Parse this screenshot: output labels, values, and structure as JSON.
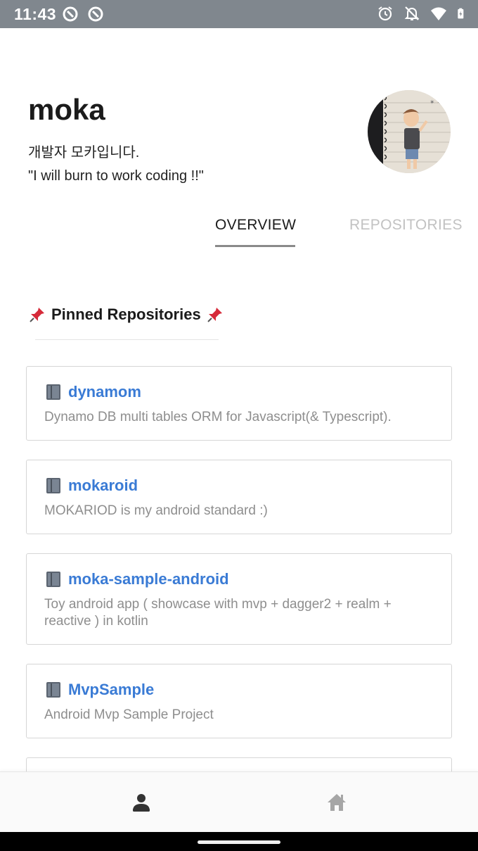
{
  "status_bar": {
    "time": "11:43",
    "left_icons": [
      "notification-circle-icon",
      "notification-circle-icon"
    ],
    "right_icons": [
      "alarm-icon",
      "notifications-off-icon",
      "wifi-icon",
      "battery-charging-icon"
    ]
  },
  "profile": {
    "name": "moka",
    "bio_line1": "개발자 모카입니다.",
    "bio_line2": "\"I will burn to work coding !!\""
  },
  "tabs": [
    {
      "label": "OVERVIEW",
      "active": true
    },
    {
      "label": "REPOSITORIES",
      "active": false
    }
  ],
  "pinned": {
    "title": "Pinned Repositories",
    "icon": "pushpin-icon"
  },
  "repos": [
    {
      "name": "dynamom",
      "description": "Dynamo DB multi tables ORM for Javascript(& Typescript)."
    },
    {
      "name": "mokaroid",
      "description": "MOKARIOD is my android standard :)"
    },
    {
      "name": "moka-sample-android",
      "description": "Toy android app ( showcase with mvp + dagger2 + realm + reactive ) in kotlin"
    },
    {
      "name": "MvpSample",
      "description": "Android Mvp Sample Project"
    }
  ],
  "bottom_nav": {
    "items": [
      {
        "icon": "person-icon",
        "active": true
      },
      {
        "icon": "home-icon",
        "active": false
      }
    ]
  },
  "colors": {
    "status_bar": "#80878e",
    "repo_link": "#3a7bd5",
    "inactive_tab": "#c2c2c2",
    "description": "#8e8e8e"
  }
}
